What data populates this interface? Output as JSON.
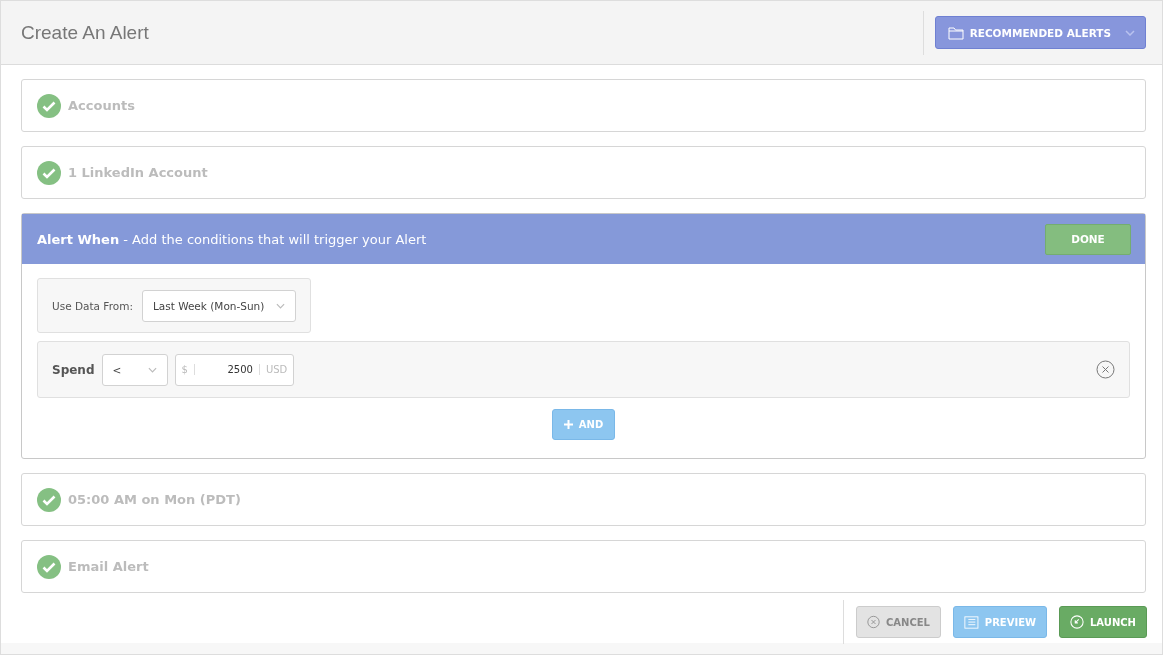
{
  "header": {
    "title": "Create An Alert",
    "recommended_button": "RECOMMENDED ALERTS"
  },
  "steps": [
    {
      "kind": "done",
      "label": "Accounts"
    },
    {
      "kind": "done",
      "label": "1 LinkedIn Account"
    },
    {
      "kind": "editing",
      "title": "Alert When",
      "subtitle": " - Add the conditions that will trigger your Alert",
      "done_button": "DONE",
      "data_from": {
        "label": "Use Data From:",
        "value": "Last Week (Mon-Sun)"
      },
      "condition": {
        "metric": "Spend",
        "operator": "<",
        "prefix": "$",
        "value": "2500",
        "suffix": "USD"
      },
      "and_button": "AND"
    },
    {
      "kind": "done",
      "label": "05:00 AM on Mon (PDT)"
    },
    {
      "kind": "done",
      "label": "Email Alert"
    }
  ],
  "footer": {
    "cancel": "CANCEL",
    "preview": "PREVIEW",
    "launch": "LAUNCH"
  }
}
